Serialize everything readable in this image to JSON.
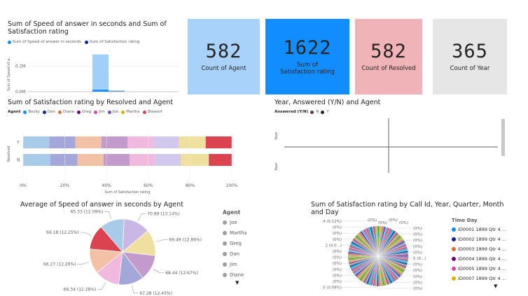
{
  "visuals": {
    "speed_satisfaction": {
      "title": "Sum of Speed of answer in seconds and Sum of Satisfaction rating",
      "legend": [
        {
          "label": "Sum of Speed of answer in seconds",
          "color": "#a0cff8"
        },
        {
          "label": "Sum of Satisfaction rating",
          "color": "#1e4f9b"
        }
      ],
      "yaxis_label": "Sum of Speed of a...",
      "yticks": [
        "0.2M",
        "0.0M"
      ]
    },
    "cards": [
      {
        "value": "582",
        "label": "Count of Agent",
        "bg": "#a8d2fa",
        "fg": "#252423"
      },
      {
        "value": "1622",
        "label": "Sum of Satisfaction rating",
        "bg": "#118dff",
        "fg": "#252423"
      },
      {
        "value": "582",
        "label": "Count of Resolved",
        "bg": "#f0b3b8",
        "fg": "#252423"
      },
      {
        "value": "365",
        "label": "Count of Year",
        "bg": "#e6e6e6",
        "fg": "#252423"
      }
    ],
    "year_answered": {
      "title": "Year, Answered (Y/N) and Agent",
      "legend_title": "Answered (Y/N)",
      "legend": [
        {
          "label": "N",
          "color": "#5c3b2e"
        },
        {
          "label": "Y",
          "color": "#252423"
        }
      ],
      "yaxis_labels": [
        "Year",
        "Year"
      ]
    },
    "resolved_agent": {
      "title": "Sum of Satisfaction rating by Resolved and Agent",
      "legend_title": "Agent",
      "ylabel": "Resolved",
      "xlabel": "Sum of Satisfaction rating"
    },
    "avg_speed_pie": {
      "title": "Average of Speed of answer in seconds by Agent",
      "agent_header": "Agent",
      "agent_items": [
        "Joe",
        "Martha",
        "Greg",
        "Dan",
        "Jim",
        "Diane"
      ]
    },
    "call_pie": {
      "title": "Sum of Satisfaction rating by Call Id, Year, Quarter, Month and Day",
      "legend_header": "Time Day",
      "legend_items": [
        {
          "label": "ID0001 1899 Qtr 4 ...",
          "color": "#118dff"
        },
        {
          "label": "ID0002 1899 Qtr 4 ...",
          "color": "#12239e"
        },
        {
          "label": "ID0003 1899 Qtr 4 ...",
          "color": "#e66c37"
        },
        {
          "label": "ID0004 1899 Qtr 4 ...",
          "color": "#6b007b"
        },
        {
          "label": "ID0005 1899 Qtr 4 ...",
          "color": "#e044a7"
        },
        {
          "label": "ID0007 1899 Qtr 4 ...",
          "color": "#d9b300"
        }
      ],
      "labels_left": [
        "4 (0.12%)",
        "(0%)",
        "(0%)",
        "(0%)",
        "2 (0.0...)",
        "(0%)",
        "(0%)",
        "(0%)",
        "(0%)",
        "(0%)",
        "(0%)",
        "5 (0.09%)"
      ],
      "labels_top": [
        "(0%)",
        "(0%)",
        "(0%)",
        "(0%)"
      ],
      "labels_right": [
        "(0%)",
        "(0%)",
        "(0%)",
        "(0%)",
        "(0%)",
        "5 (0...)",
        "(0%)",
        "(0%)",
        "(0%)",
        "(0%)",
        "(0%)"
      ]
    }
  },
  "chart_data": [
    {
      "type": "bar",
      "categories": [
        "",
        ""
      ],
      "series": [
        {
          "name": "Sum of Speed of answer in seconds",
          "values": [
            0.29,
            0.01
          ]
        },
        {
          "name": "Sum of Satisfaction rating",
          "values": [
            0.015,
            0.003
          ]
        }
      ],
      "ylim": [
        0,
        0.3
      ],
      "yticks": [
        "0.0M",
        "0.2M"
      ],
      "ylabel": "Sum of Speed of a...",
      "title": "Sum of Speed of answer in seconds and Sum of Satisfaction rating"
    },
    {
      "type": "bar",
      "orientation": "horizontal-stacked-100",
      "title": "Sum of Satisfaction rating by Resolved and Agent",
      "categories": [
        "Y",
        "N"
      ],
      "xlabel": "Sum of Satisfaction rating",
      "ylabel": "Resolved",
      "xticks": [
        "0%",
        "20%",
        "40%",
        "60%",
        "80%",
        "100%"
      ],
      "series": [
        {
          "name": "Becky",
          "color": "#a9cbea",
          "values": [
            12.5,
            13
          ]
        },
        {
          "name": "Dan",
          "color": "#a4a7da",
          "values": [
            12.5,
            13
          ]
        },
        {
          "name": "Diane",
          "color": "#f3c2a6",
          "values": [
            12.5,
            12.5
          ]
        },
        {
          "name": "Greg",
          "color": "#c29bcc",
          "values": [
            12.5,
            12.5
          ]
        },
        {
          "name": "Jim",
          "color": "#f1b9dd",
          "values": [
            12.5,
            12
          ]
        },
        {
          "name": "Joe",
          "color": "#d2c7ec",
          "values": [
            12,
            12.5
          ]
        },
        {
          "name": "Martha",
          "color": "#f0e09f",
          "values": [
            13,
            13.5
          ]
        },
        {
          "name": "Stewart",
          "color": "#dc4350",
          "values": [
            12.5,
            11
          ]
        }
      ]
    },
    {
      "type": "scatter",
      "title": "Year, Answered (Y/N) and Agent",
      "xlabel": "",
      "ylabel": "Year",
      "series": [
        {
          "name": "N",
          "color": "#5c3b2e",
          "values": []
        },
        {
          "name": "Y",
          "color": "#252423",
          "values": []
        }
      ]
    },
    {
      "type": "pie",
      "title": "Average of Speed of answer in seconds by Agent",
      "slices": [
        {
          "name": "Joe",
          "value": 70.99,
          "label": "70.99 (13.14%)",
          "color": "#c9b8e6"
        },
        {
          "name": "Martha",
          "value": 69.49,
          "label": "69.49 (12.86%)",
          "color": "#f0e09f"
        },
        {
          "name": "Greg",
          "value": 68.44,
          "label": "68.44 (12.67%)",
          "color": "#c29bcc"
        },
        {
          "name": "Dan",
          "value": 67.28,
          "label": "67.28 (12.45%)",
          "color": "#a4a7da"
        },
        {
          "name": "Jim",
          "value": 66.34,
          "label": "66.34 (12.28%)",
          "color": "#f1b9dd"
        },
        {
          "name": "Diane",
          "value": 66.27,
          "label": "66.27 (12.26%)",
          "color": "#f3c2a6"
        },
        {
          "name": "Stewart",
          "value": 66.18,
          "label": "66.18 (12.25%)",
          "color": "#dc4350"
        },
        {
          "name": "Becky",
          "value": 65.33,
          "label": "65.33 (12.09%)",
          "color": "#a9cbea"
        }
      ]
    },
    {
      "type": "pie",
      "title": "Sum of Satisfaction rating by Call Id, Year, Quarter, Month and Day",
      "note_slices": "many thin slices",
      "slices": []
    }
  ]
}
